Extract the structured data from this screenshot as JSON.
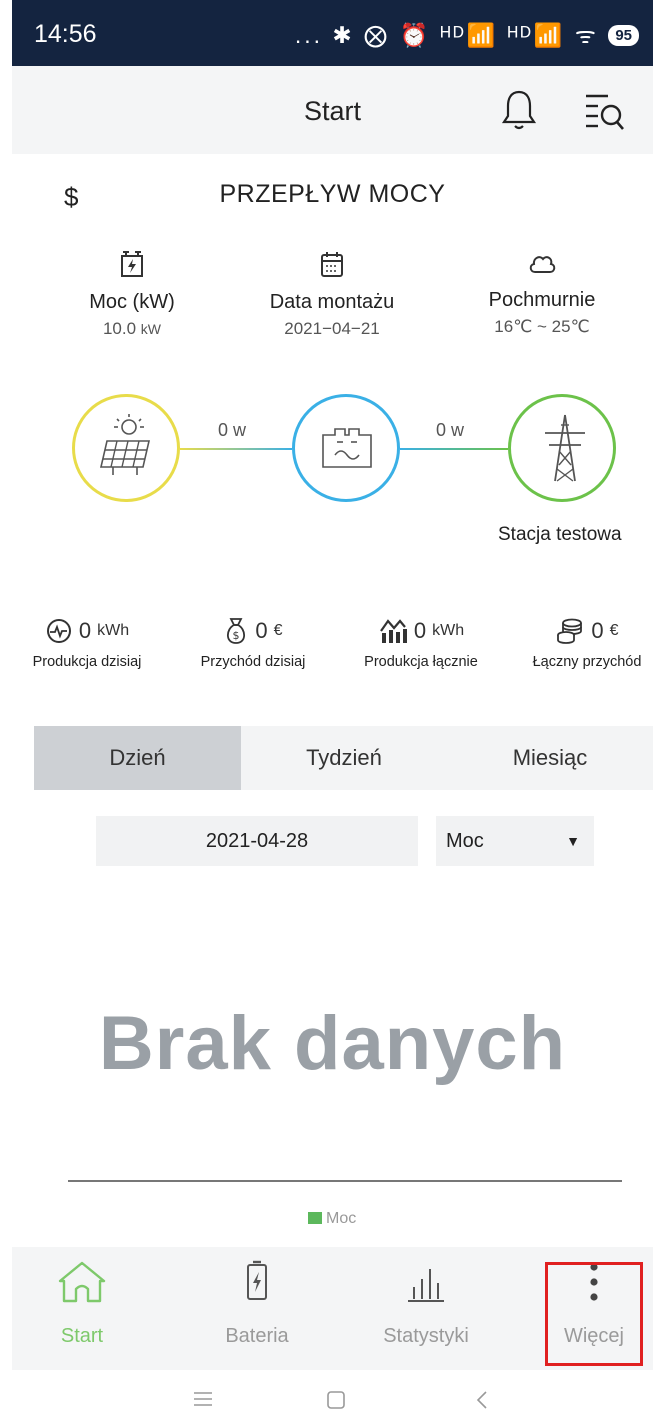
{
  "status_bar": {
    "time": "14:56",
    "icons_text": "... ✱ ⨂ ⏰ ᴴᴰ📶 ᴴᴰ📶 ᯤ",
    "battery": "95"
  },
  "header": {
    "title": "Start"
  },
  "power_flow": {
    "currency_symbol": "$",
    "title": "PRZEPŁYW MOCY",
    "info": [
      {
        "icon": "battery-charge-icon",
        "label": "Moc (kW)",
        "value": "10.0",
        "unit": "kW"
      },
      {
        "icon": "calendar-icon",
        "label": "Data montażu",
        "value": "2021−04−21",
        "unit": ""
      },
      {
        "icon": "cloud-icon",
        "label": "Pochmurnie",
        "value": "16℃ ~ 25℃",
        "unit": ""
      }
    ],
    "flow_left": "0 w",
    "flow_right": "0 w",
    "station_name": "Stacja testowa"
  },
  "stats": [
    {
      "icon": "production-gauge-icon",
      "value": "0",
      "unit": "kWh",
      "label": "Produkcja dzisiaj"
    },
    {
      "icon": "money-bag-icon",
      "value": "0",
      "unit": "€",
      "label": "Przychód dzisiaj"
    },
    {
      "icon": "production-chart-icon",
      "value": "0",
      "unit": "kWh",
      "label": "Produkcja łącznie"
    },
    {
      "icon": "coins-icon",
      "value": "0",
      "unit": "€",
      "label": "Łączny przychód"
    }
  ],
  "tabs": [
    "Dzień",
    "Tydzień",
    "Miesiąc"
  ],
  "active_tab": "Dzień",
  "date_value": "2021-04-28",
  "metric_select": {
    "value": "Moc",
    "arrow": "▼"
  },
  "no_data_text": "Brak danych",
  "legend_label": "Moc",
  "bottom_nav": {
    "items": [
      {
        "icon": "home-icon",
        "label": "Start",
        "active": true
      },
      {
        "icon": "battery-icon",
        "label": "Bateria",
        "active": false
      },
      {
        "icon": "bar-chart-icon",
        "label": "Statystyki",
        "active": false
      },
      {
        "icon": "more-vertical-icon",
        "label": "Więcej",
        "active": false
      }
    ]
  },
  "colors": {
    "status_bar": "#142440",
    "solar": "#e8dc4a",
    "battery": "#3ab0e6",
    "grid": "#6cc24a",
    "active_nav": "#7ec96b",
    "highlight": "#e02020"
  }
}
